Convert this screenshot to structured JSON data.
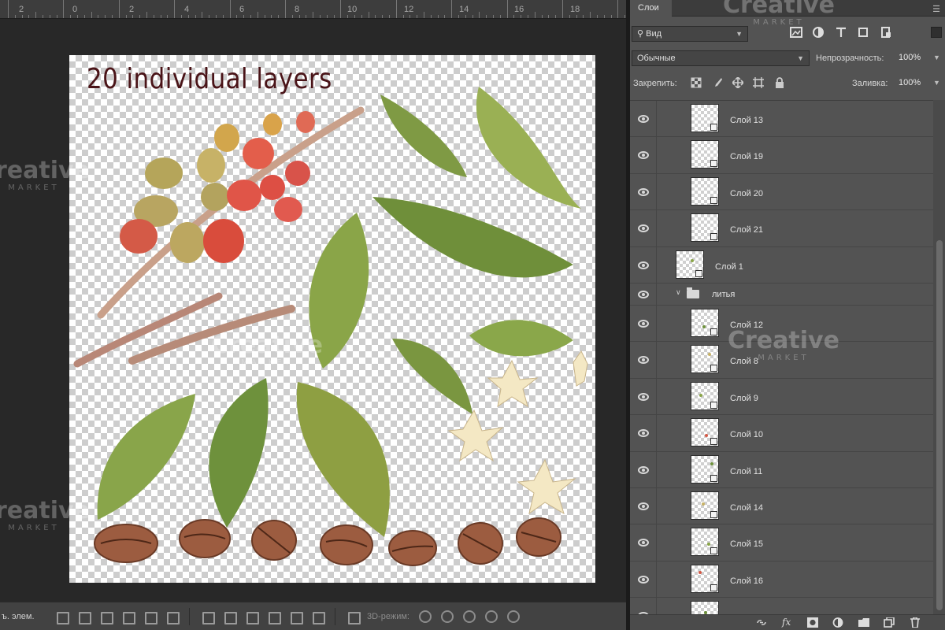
{
  "ruler": {
    "labels": [
      "2",
      "0",
      "2",
      "4",
      "6",
      "8",
      "10",
      "12",
      "14",
      "16",
      "18"
    ]
  },
  "canvas": {
    "title": "20 individual layers"
  },
  "watermark": {
    "line1": "Creative",
    "line2": "MARKET"
  },
  "bottom_toolbar": {
    "label": "ъ. элем.",
    "mode_3d_label": "3D-режим:"
  },
  "layers_panel": {
    "tab_label": "Слои",
    "filter": {
      "selected": "Вид",
      "search_icon": "search-icon"
    },
    "filter_icons": [
      "image-filter-icon",
      "adjustment-filter-icon",
      "type-filter-icon",
      "shape-filter-icon",
      "smart-object-filter-icon"
    ],
    "blend_mode": "Обычные",
    "opacity_label": "Непрозрачность:",
    "opacity_value": "100%",
    "lock_label": "Закрепить:",
    "lock_icons": [
      "lock-transparent-icon",
      "lock-pixels-icon",
      "lock-position-icon",
      "lock-artboard-icon",
      "lock-all-icon"
    ],
    "fill_label": "Заливка:",
    "fill_value": "100%",
    "layers": [
      {
        "name": "Слой 13",
        "type": "smart",
        "visible": true
      },
      {
        "name": "Слой 19",
        "type": "smart",
        "visible": true
      },
      {
        "name": "Слой 20",
        "type": "smart",
        "visible": true
      },
      {
        "name": "Слой 21",
        "type": "smart",
        "visible": true
      },
      {
        "name": "Слой 1",
        "type": "smart",
        "visible": true
      },
      {
        "name": "литья",
        "type": "group",
        "visible": true
      },
      {
        "name": "Слой 12",
        "type": "smart",
        "visible": true
      },
      {
        "name": "Слой 8",
        "type": "smart",
        "visible": true
      },
      {
        "name": "Слой 9",
        "type": "smart",
        "visible": true
      },
      {
        "name": "Слой 10",
        "type": "smart",
        "visible": true
      },
      {
        "name": "Слой 11",
        "type": "smart",
        "visible": true
      },
      {
        "name": "Слой 14",
        "type": "smart",
        "visible": true
      },
      {
        "name": "Слой 15",
        "type": "smart",
        "visible": true
      },
      {
        "name": "Слой 16",
        "type": "smart",
        "visible": true
      },
      {
        "name": "",
        "type": "smart",
        "visible": true
      }
    ],
    "footer_icons": [
      "link-layers-icon",
      "fx-icon",
      "mask-icon",
      "adjustment-layer-icon",
      "new-group-icon",
      "new-layer-icon",
      "delete-icon"
    ],
    "footer_fx_label": "fx"
  },
  "colors": {
    "panel_bg": "#535353",
    "canvas_title": "#4a1418",
    "workspace": "#282828"
  }
}
